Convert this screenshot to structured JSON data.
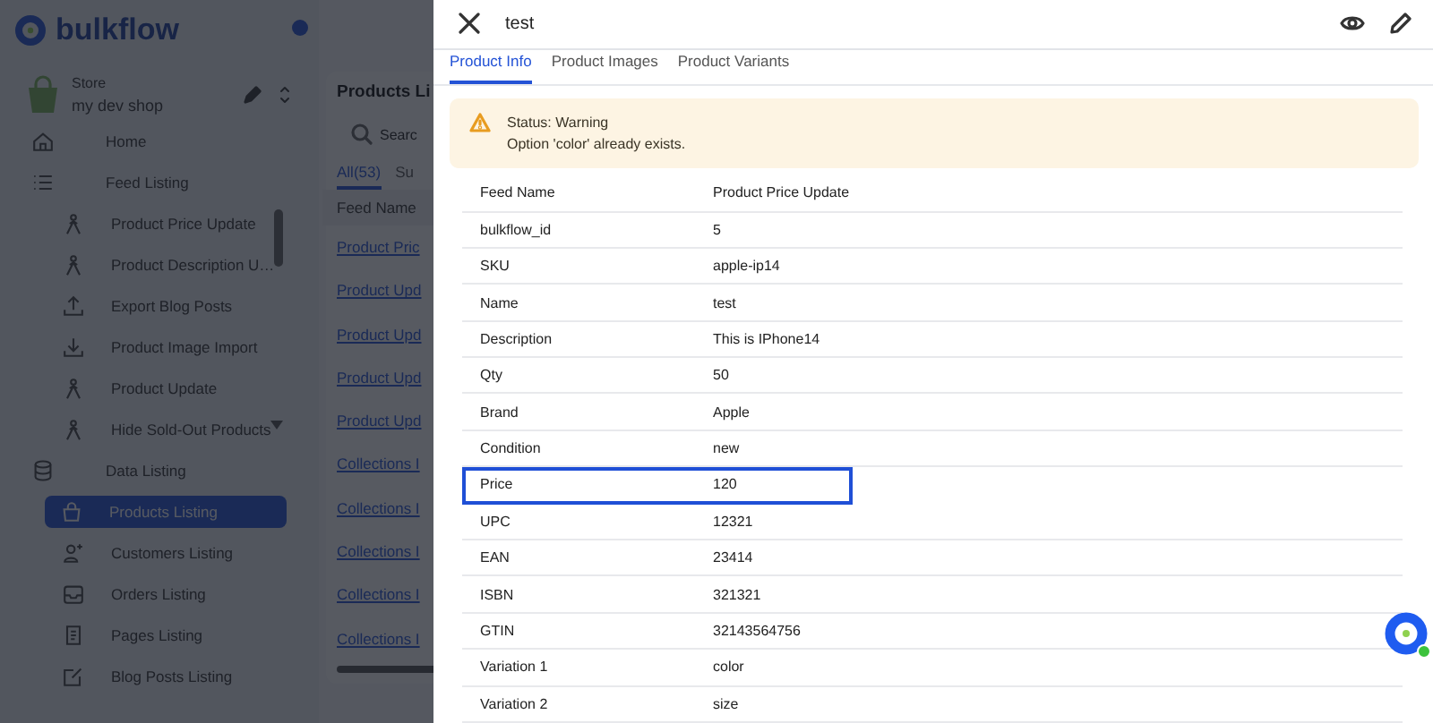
{
  "app": {
    "logo": "bulkflow",
    "store": {
      "label": "Store",
      "name": "my dev shop"
    },
    "nav": [
      {
        "kind": "item",
        "label": "Home",
        "selected": false
      },
      {
        "kind": "group",
        "label": "Feed Listing",
        "selected": false,
        "children": [
          {
            "label": "Product Price Update",
            "selected": false
          },
          {
            "label": "Product Description U…",
            "selected": false
          },
          {
            "label": "Export Blog Posts",
            "selected": false
          },
          {
            "label": "Product Image Import",
            "selected": false
          },
          {
            "label": "Product Update",
            "selected": false
          },
          {
            "label": "Hide Sold-Out Products",
            "selected": false
          }
        ]
      },
      {
        "kind": "group",
        "label": "Data Listing",
        "selected": false,
        "children": [
          {
            "label": "Products Listing",
            "selected": true
          },
          {
            "label": "Customers Listing",
            "selected": false
          },
          {
            "label": "Orders Listing",
            "selected": false
          },
          {
            "label": "Pages Listing",
            "selected": false
          },
          {
            "label": "Blog Posts Listing",
            "selected": false
          }
        ]
      }
    ],
    "main": {
      "title": "Products Li",
      "search_placeholder": "Searc",
      "tabs": [
        {
          "label": "All(53)",
          "selected": true
        },
        {
          "label": "Su",
          "selected": false
        }
      ],
      "column": "Feed Name",
      "links": [
        "Product Pric",
        "Product Upd",
        "Product Upd",
        "Product Upd",
        "Product Upd",
        "Collections I",
        "Collections I",
        "Collections I",
        "Collections I",
        "Collections I"
      ]
    }
  },
  "drawer": {
    "title": "test",
    "tabs": [
      {
        "label": "Product Info",
        "selected": true
      },
      {
        "label": "Product Images",
        "selected": false
      },
      {
        "label": "Product Variants",
        "selected": false
      }
    ],
    "alert": {
      "title": "Status: Warning",
      "message": "Option 'color' already exists."
    },
    "rows": [
      {
        "field": "Feed Name",
        "value": "Product Price Update",
        "highlighted": false
      },
      {
        "field": "bulkflow_id",
        "value": "5",
        "highlighted": false
      },
      {
        "field": "SKU",
        "value": "apple-ip14",
        "highlighted": false
      },
      {
        "field": "Name",
        "value": "test",
        "highlighted": false
      },
      {
        "field": "Description",
        "value": "This is IPhone14",
        "highlighted": false
      },
      {
        "field": "Qty",
        "value": "50",
        "highlighted": false
      },
      {
        "field": "Brand",
        "value": "Apple",
        "highlighted": false
      },
      {
        "field": "Condition",
        "value": "new",
        "highlighted": false
      },
      {
        "field": "Price",
        "value": "120",
        "highlighted": true
      },
      {
        "field": "UPC",
        "value": "12321",
        "highlighted": false
      },
      {
        "field": "EAN",
        "value": "23414",
        "highlighted": false
      },
      {
        "field": "ISBN",
        "value": "321321",
        "highlighted": false
      },
      {
        "field": "GTIN",
        "value": "32143564756",
        "highlighted": false
      },
      {
        "field": "Variation 1",
        "value": "color",
        "highlighted": false
      },
      {
        "field": "Variation 2",
        "value": "size",
        "highlighted": false
      }
    ]
  }
}
